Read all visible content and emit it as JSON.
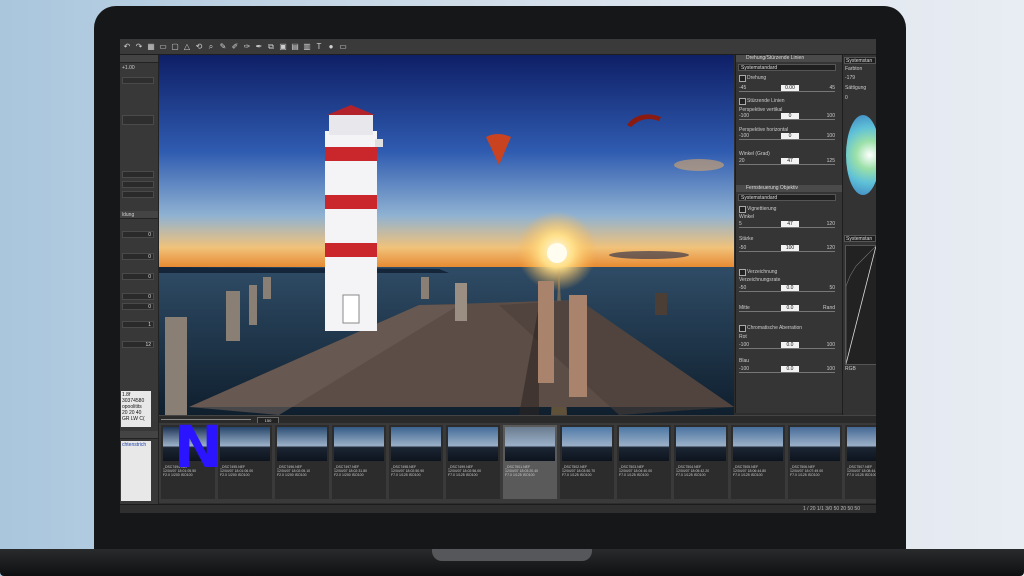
{
  "toolbar": {
    "icons": [
      "undo-icon",
      "redo-icon",
      "grid-icon",
      "crop-icon",
      "square-icon",
      "warning-icon",
      "rotate-icon",
      "zoom-icon",
      "brush-icon",
      "eyedropper-icon",
      "picker-icon",
      "dropper-icon",
      "clone-icon",
      "lock-icon",
      "image-icon",
      "stamp-icon",
      "text-icon",
      "color-icon",
      "monitor-icon"
    ]
  },
  "left_panel": {
    "rows": [
      "0",
      "0",
      "0",
      "0",
      "0",
      "1",
      "12"
    ],
    "top_value": "+1.00",
    "header_label": "ldung",
    "info_lines": [
      "1.8f",
      "30374580",
      "opoolitits",
      "20 20 40",
      "GR LW C("
    ],
    "text_block": "chtenstrich"
  },
  "right_panel": {
    "section1_title": "Drehung/Stürzende Linien",
    "section1_select": "Systemstandard",
    "rotation": {
      "label": "Drehung",
      "min": "-45",
      "value": "0.00",
      "max": "45"
    },
    "sturz_title": "Stürzende Linien",
    "perspective_v": {
      "label": "Perspektive vertikal",
      "min": "-100",
      "value": "0",
      "max": "100"
    },
    "perspective_h": {
      "label": "Perspektive horizontal",
      "min": "-100",
      "value": "0",
      "max": "100"
    },
    "angle": {
      "label": "Winkel (Grad)",
      "min": "20",
      "value": "47",
      "max": "125"
    },
    "section2_title": "Fernsteuerung Objektiv",
    "section2_select": "Systemstandard",
    "vignette_title": "Vignettierung",
    "vig_angle": {
      "label": "Winkel",
      "min": "5",
      "value": "47",
      "max": "120"
    },
    "vig_strength": {
      "label": "Stärke",
      "min": "-50",
      "value": "100",
      "max": "120"
    },
    "distortion_title": "Verzeichnung",
    "dist_strength": {
      "label": "Verzeichnungsrate",
      "min": "-50",
      "value": "0.0",
      "max": "50"
    },
    "dist_mid": {
      "label": "Mitte",
      "value": "0.0",
      "max": "Rand"
    },
    "chromatic_title": "Chromatische Aberration",
    "red": {
      "label": "Rot",
      "min": "-100",
      "value": "0.0",
      "max": "100"
    },
    "blue": {
      "label": "Blau",
      "min": "-100",
      "value": "0.0",
      "max": "100"
    }
  },
  "far_panel": {
    "select": "Systemstan",
    "label1": "Farbton",
    "value1": "-179",
    "label2": "Sättigung",
    "value2": "0",
    "label3": "Systemstan",
    "channel": "RGB"
  },
  "filmbar": {
    "zoom_value": "150"
  },
  "filmstrip": [
    {
      "cap": "_DSC7494.NEF\n12/04/07 18:01:05.50\nF2.0 1/200 ISO100",
      "sel": false
    },
    {
      "cap": "_DSC7495.NEF\n12/04/07 18:01:06.00\nF2.0 1/200 ISO100",
      "sel": false
    },
    {
      "cap": "_DSC7496.NEF\n12/04/07 18:02:05.10\nF2.0 1/200 ISO100",
      "sel": false
    },
    {
      "cap": "_DSC7497.NEF\n12/04/07 18:02:31.80\nF2.0 1/200 ISO100",
      "sel": false
    },
    {
      "cap": "_DSC7498.NEF\n12/04/07 18:02:50.90\nF7.0 1/125 ISO100",
      "sel": false
    },
    {
      "cap": "_DSC7499.NEF\n12/04/07 18:02:56.00\nF7.0 1/125 ISO100",
      "sel": false
    },
    {
      "cap": "_DSC7501.NEF\n12/04/07 18:03:20.40\nF7.0 1/125 ISO100",
      "sel": true
    },
    {
      "cap": "_DSC7502.NEF\n12/04/07 18:03:50.70\nF7.0 1/125 ISO100",
      "sel": false
    },
    {
      "cap": "_DSC7503.NEF\n12/04/07 18:04:40.00\nF7.0 1/125 ISO100",
      "sel": false
    },
    {
      "cap": "_DSC7504.NEF\n12/04/07 18:05:42.20\nF7.0 1/125 ISO100",
      "sel": false
    },
    {
      "cap": "_DSC7505.NEF\n12/04/07 18:06:44.80\nF7.0 1/125 ISO100",
      "sel": false
    },
    {
      "cap": "_DSC7506.NEF\n12/04/07 18:07:49.00\nF7.0 1/125 ISO100",
      "sel": false
    },
    {
      "cap": "_DSC7507.NEF\n12/04/07 18:08:44.50\nF7.0 1/125 ISO100",
      "sel": false
    }
  ],
  "statusbar": {
    "text": "1 / 20  1/1  3/0  50  20  50  50"
  },
  "logo": {
    "letter": "N",
    "color": "#2b14ff"
  }
}
